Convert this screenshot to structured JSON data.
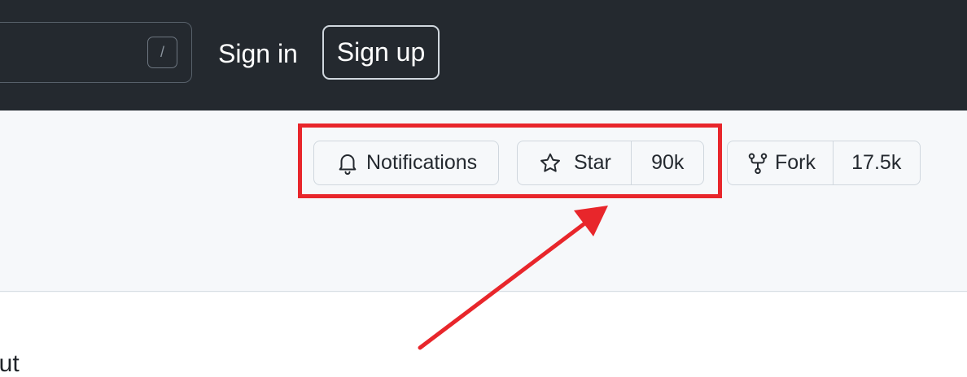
{
  "header": {
    "search_shortcut": "/",
    "signin_label": "Sign in",
    "signup_label": "Sign up"
  },
  "repo_actions": {
    "notifications": {
      "label": "Notifications",
      "icon": "bell-icon"
    },
    "star": {
      "label": "Star",
      "count": "90k",
      "icon": "star-icon"
    },
    "fork": {
      "label": "Fork",
      "count": "17.5k",
      "icon": "repo-forked-icon"
    }
  },
  "content": {
    "about_heading_fragment": "out"
  },
  "annotation": {
    "color": "#e8262b",
    "type": "highlight-box-with-arrow"
  },
  "colors": {
    "header_bg": "#24292f",
    "page_bg": "#f6f8fa",
    "button_border": "#d0d7de"
  }
}
